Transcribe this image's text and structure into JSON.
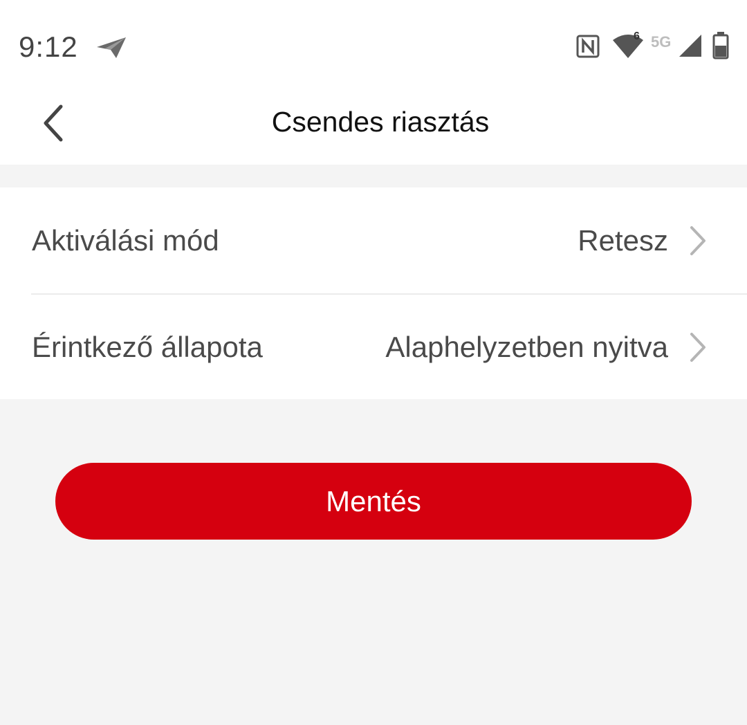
{
  "status_bar": {
    "time": "9:12",
    "network_label": "5G",
    "wifi_badge": "6",
    "icons": [
      "send-icon",
      "nfc-icon",
      "wifi-icon",
      "cellular-signal-icon",
      "battery-icon"
    ]
  },
  "header": {
    "title": "Csendes riasztás",
    "back_icon": "chevron-left-icon"
  },
  "settings": {
    "items": [
      {
        "label": "Aktiválási mód",
        "value": "Retesz",
        "icon": "chevron-right-icon"
      },
      {
        "label": "Érintkező állapota",
        "value": "Alaphelyzetben nyitva",
        "icon": "chevron-right-icon"
      }
    ]
  },
  "actions": {
    "save_label": "Mentés"
  },
  "colors": {
    "accent": "#d5000f",
    "background": "#f4f4f4",
    "surface": "#ffffff",
    "text_primary": "#111111",
    "text_secondary": "#4a4a4a",
    "chevron": "#b5b5b5"
  }
}
